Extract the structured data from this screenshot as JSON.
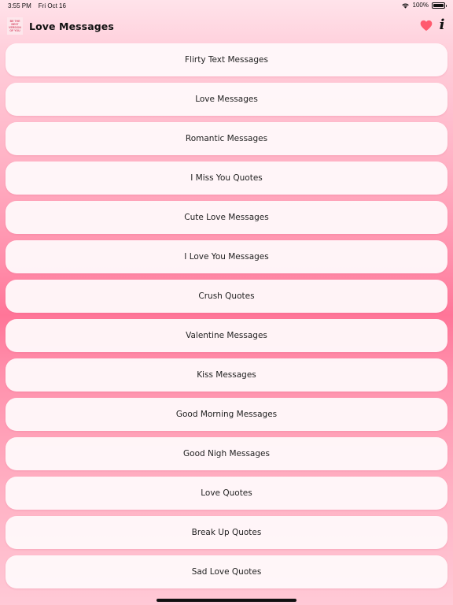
{
  "status_bar": {
    "time": "3:55 PM",
    "date": "Fri Oct 16",
    "battery": "100%",
    "battery_level": 1.0
  },
  "header": {
    "logo_text": [
      "BE THE",
      "BEST",
      "VERSION",
      "OF YOU"
    ],
    "title": "Love Messages",
    "icons": {
      "favorites": "heart-icon",
      "info": "info-icon"
    },
    "heart_color": "#ff5a6e"
  },
  "menu": {
    "items": [
      "Flirty Text Messages",
      "Love Messages",
      "Romantic Messages",
      "I Miss You Quotes",
      "Cute Love Messages",
      "I Love You Messages",
      "Crush Quotes",
      "Valentine Messages",
      "Kiss Messages",
      "Good Morning Messages",
      "Good Nigh Messages",
      "Love Quotes",
      "Break Up Quotes",
      "Sad Love Quotes"
    ]
  }
}
